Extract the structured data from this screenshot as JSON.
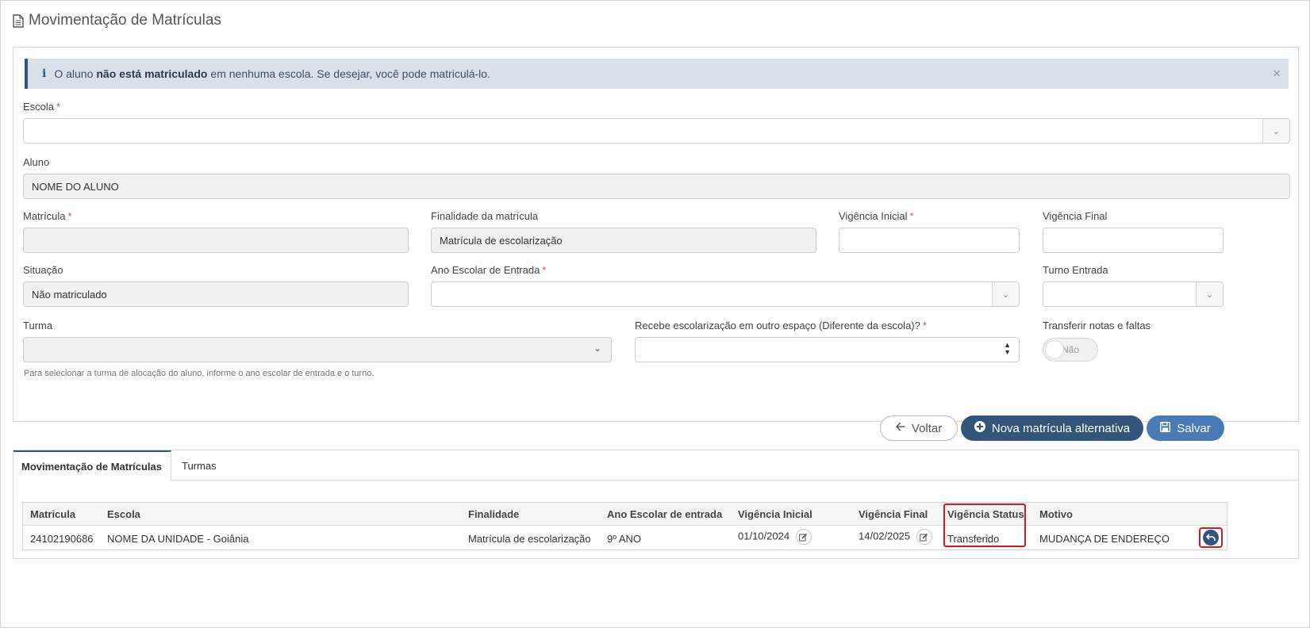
{
  "page": {
    "title": "Movimentação de Matrículas"
  },
  "alert": {
    "prefix": "O aluno",
    "bold": "não está matriculado",
    "suffix": "em nenhuma escola. Se desejar, você pode matriculá-lo.",
    "close": "×"
  },
  "form": {
    "escola": {
      "label": "Escola",
      "value": ""
    },
    "aluno": {
      "label": "Aluno",
      "value": "NOME DO ALUNO"
    },
    "matricula": {
      "label": "Matrícula",
      "value": ""
    },
    "finalidade": {
      "label": "Finalidade da matrícula",
      "value": "Matrícula de escolarização"
    },
    "vigencia_inicial": {
      "label": "Vigência Inicial",
      "value": ""
    },
    "vigencia_final": {
      "label": "Vigência Final",
      "value": ""
    },
    "situacao": {
      "label": "Situação",
      "value": "Não matriculado"
    },
    "ano_escolar": {
      "label": "Ano Escolar de Entrada",
      "value": ""
    },
    "turno_entrada": {
      "label": "Turno Entrada",
      "value": ""
    },
    "turma": {
      "label": "Turma",
      "value": "",
      "hint": "Para selecionar a turma de alocação do aluno, informe o ano escolar de entrada e o turno."
    },
    "outro_espaco": {
      "label": "Recebe escolarização em outro espaço (Diferente da escola)?",
      "value": ""
    },
    "transferir": {
      "label": "Transferir notas e faltas",
      "toggle_value": "Não"
    },
    "required_mark": "*"
  },
  "actions": {
    "voltar": "Voltar",
    "nova": "Nova matrícula alternativa",
    "salvar": "Salvar"
  },
  "tabs": [
    {
      "label": "Movimentação de Matrículas",
      "active": true
    },
    {
      "label": "Turmas",
      "active": false
    }
  ],
  "table": {
    "headers": [
      "Matricula",
      "Escola",
      "Finalidade",
      "Ano Escolar de entrada",
      "Vigência Inicial",
      "Vigência Final",
      "Vigência Status",
      "Motivo"
    ],
    "rows": [
      [
        "24102190686",
        "NOME DA UNIDADE - Goiânia",
        "Matrícula de escolarização",
        "9º ANO",
        "01/10/2024",
        "14/02/2025",
        "Transferido",
        "MUDANÇA DE ENDEREÇO"
      ]
    ]
  },
  "colors": {
    "primary": "#34557a",
    "secondary": "#4a7bb7",
    "highlight": "#e0141e",
    "alert_bg": "#d9e0ea"
  },
  "icons": [
    "document-icon",
    "info-icon",
    "close-icon",
    "chevron-down-icon",
    "updown-icon",
    "arrow-left-icon",
    "plus-circle-icon",
    "save-icon",
    "edit-icon",
    "undo-icon"
  ]
}
